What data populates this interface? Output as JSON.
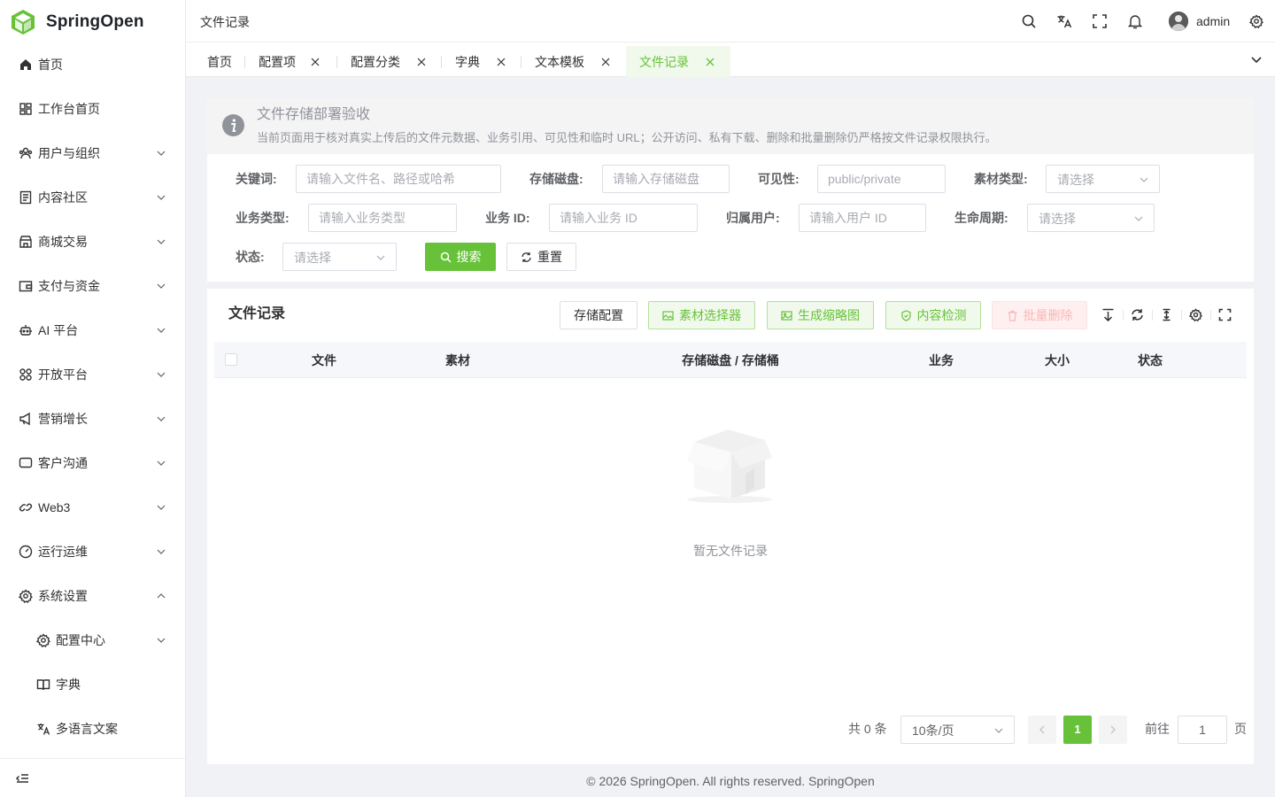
{
  "app": {
    "name": "SpringOpen"
  },
  "sidebar": {
    "items": [
      {
        "label": "首页",
        "icon": "home-icon"
      },
      {
        "label": "工作台首页",
        "icon": "dashboard-icon"
      },
      {
        "label": "用户与组织",
        "icon": "users-icon"
      },
      {
        "label": "内容社区",
        "icon": "document-icon"
      },
      {
        "label": "商城交易",
        "icon": "shop-icon"
      },
      {
        "label": "支付与资金",
        "icon": "wallet-icon"
      },
      {
        "label": "AI 平台",
        "icon": "robot-icon"
      },
      {
        "label": "开放平台",
        "icon": "apps-icon"
      },
      {
        "label": "营销增长",
        "icon": "megaphone-icon"
      },
      {
        "label": "客户沟通",
        "icon": "chat-icon"
      },
      {
        "label": "Web3",
        "icon": "link-icon"
      },
      {
        "label": "运行运维",
        "icon": "gauge-icon"
      },
      {
        "label": "系统设置",
        "icon": "gear-icon"
      }
    ],
    "sub_items": [
      {
        "label": "配置中心",
        "icon": "gear-icon"
      },
      {
        "label": "字典",
        "icon": "book-icon"
      },
      {
        "label": "多语言文案",
        "icon": "translate-icon"
      }
    ]
  },
  "header": {
    "breadcrumb": "文件记录",
    "username": "admin"
  },
  "tabs": [
    {
      "label": "首页"
    },
    {
      "label": "配置项"
    },
    {
      "label": "配置分类"
    },
    {
      "label": "字典"
    },
    {
      "label": "文本模板"
    },
    {
      "label": "文件记录"
    }
  ],
  "alert": {
    "title": "文件存储部署验收",
    "description": "当前页面用于核对真实上传后的文件元数据、业务引用、可见性和临时 URL；公开访问、私有下载、删除和批量删除仍严格按文件记录权限执行。"
  },
  "filter": {
    "keyword": {
      "label": "关键词:",
      "placeholder": "请输入文件名、路径或哈希"
    },
    "disk": {
      "label": "存储磁盘:",
      "placeholder": "请输入存储磁盘"
    },
    "visibility": {
      "label": "可见性:",
      "placeholder": "public/private"
    },
    "material_type": {
      "label": "素材类型:",
      "placeholder": "请选择"
    },
    "biz_type": {
      "label": "业务类型:",
      "placeholder": "请输入业务类型"
    },
    "biz_id": {
      "label": "业务 ID:",
      "placeholder": "请输入业务 ID"
    },
    "owner": {
      "label": "归属用户:",
      "placeholder": "请输入用户 ID"
    },
    "lifecycle": {
      "label": "生命周期:",
      "placeholder": "请选择"
    },
    "status": {
      "label": "状态:",
      "placeholder": "请选择"
    },
    "search_label": "搜索",
    "reset_label": "重置"
  },
  "table": {
    "title": "文件记录",
    "actions": {
      "storage_config": "存储配置",
      "material_picker": "素材选择器",
      "thumbnail": "生成缩略图",
      "content_check": "内容检测",
      "batch_delete": "批量删除"
    },
    "columns": [
      "文件",
      "素材",
      "存储磁盘 / 存储桶",
      "业务",
      "大小",
      "状态"
    ],
    "empty_text": "暂无文件记录"
  },
  "pagination": {
    "total": "共 0 条",
    "page_size": "10条/页",
    "current": "1",
    "goto_label": "前往",
    "goto_value": "1",
    "page_suffix": "页"
  },
  "footer": "© 2026 SpringOpen. All rights reserved. SpringOpen",
  "colors": {
    "primary": "#67c23a",
    "danger_light": "#fab6b6"
  }
}
